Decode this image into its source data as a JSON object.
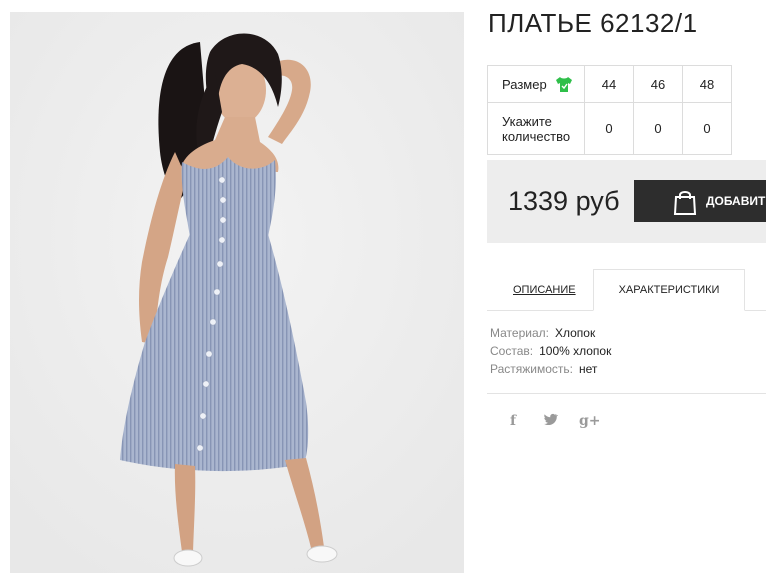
{
  "product": {
    "title": "ПЛАТЬЕ 62132/1",
    "image_alt": "photo of blue striped sundress with buttons"
  },
  "sizes_table": {
    "size_label": "Размер",
    "qty_label_line1": "Укажите",
    "qty_label_line2": "количество",
    "sizes": [
      "44",
      "46",
      "48"
    ],
    "quantities": [
      "0",
      "0",
      "0"
    ]
  },
  "purchase": {
    "price": "1339 руб",
    "add_button_label": "ДОБАВИТЬ"
  },
  "tabs": {
    "description": "ОПИСАНИЕ",
    "characteristics": "ХАРАКТЕРИСТИКИ"
  },
  "specs": [
    {
      "key": "Материал:",
      "value": "Хлопок"
    },
    {
      "key": "Состав:",
      "value": "100% хлопок"
    },
    {
      "key": "Растяжимость:",
      "value": "нет"
    }
  ],
  "social": {
    "facebook": "f",
    "twitter": "t",
    "googleplus": "g+"
  },
  "colors": {
    "accent_green": "#2fbf4a",
    "button_bg": "#2d2d2d",
    "price_bg": "#ededed"
  },
  "icons": [
    "shirt-icon",
    "shopping-bag-icon",
    "facebook-icon",
    "twitter-icon",
    "google-plus-icon"
  ]
}
